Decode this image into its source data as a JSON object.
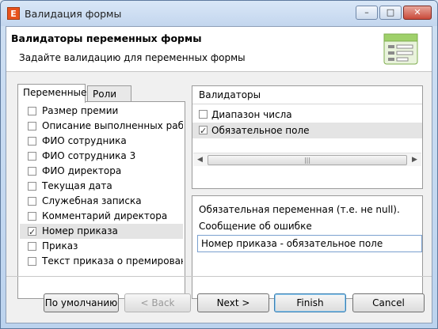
{
  "window": {
    "title": "Валидация формы",
    "app_icon_letter": "E",
    "controls": {
      "minimize": "–",
      "maximize": "□",
      "close": "✕"
    }
  },
  "header": {
    "title": "Валидаторы переменных формы",
    "description": "Задайте валидацию для переменных формы"
  },
  "tabs": [
    {
      "label": "Переменные",
      "active": true
    },
    {
      "label": "Роли",
      "active": false
    }
  ],
  "variables": [
    {
      "label": "Размер премии",
      "checked": false,
      "selected": false
    },
    {
      "label": "Описание выполненных работ",
      "checked": false,
      "selected": false
    },
    {
      "label": "ФИО сотрудника",
      "checked": false,
      "selected": false
    },
    {
      "label": "ФИО сотрудника 3",
      "checked": false,
      "selected": false
    },
    {
      "label": "ФИО директора",
      "checked": false,
      "selected": false
    },
    {
      "label": "Текущая дата",
      "checked": false,
      "selected": false
    },
    {
      "label": "Служебная записка",
      "checked": false,
      "selected": false
    },
    {
      "label": "Комментарий директора",
      "checked": false,
      "selected": false
    },
    {
      "label": "Номер приказа",
      "checked": true,
      "selected": true
    },
    {
      "label": "Приказ",
      "checked": false,
      "selected": false
    },
    {
      "label": "Текст приказа о премировани",
      "checked": false,
      "selected": false
    }
  ],
  "validators": {
    "header": "Валидаторы",
    "items": [
      {
        "label": "Диапазон числа",
        "checked": false,
        "selected": false
      },
      {
        "label": "Обязательное поле",
        "checked": true,
        "selected": true
      }
    ]
  },
  "details": {
    "note": "Обязательная переменная (т.е. не null).",
    "error_label": "Сообщение об ошибке",
    "error_value": "Номер приказа - обязательное поле"
  },
  "buttons": {
    "default": "По умолчанию",
    "back": "< Back",
    "next": "Next >",
    "finish": "Finish",
    "cancel": "Cancel"
  }
}
